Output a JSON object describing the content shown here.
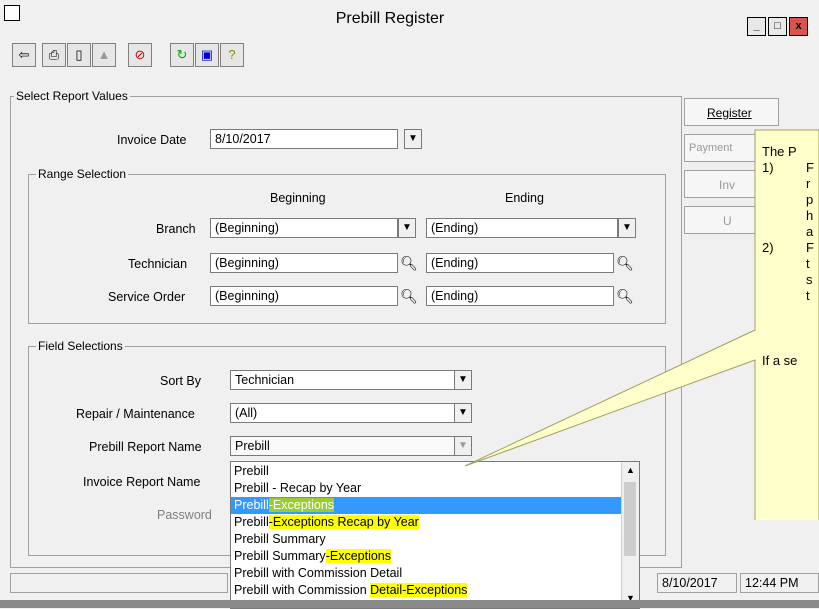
{
  "window": {
    "title": "Prebill Register",
    "minimize": "_",
    "maximize": "□",
    "close": "x"
  },
  "toolbar": [
    "exit-icon",
    "print-icon",
    "preview-icon",
    "export-icon",
    "cancel-icon",
    "refresh-icon",
    "copy-icon",
    "help-icon"
  ],
  "select_group": {
    "label": "Select Report Values"
  },
  "invoice_date": {
    "label": "Invoice Date",
    "value": "8/10/2017"
  },
  "range": {
    "label": "Range Selection",
    "col_beginning": "Beginning",
    "col_ending": "Ending",
    "branch": {
      "label": "Branch",
      "begin": "(Beginning)",
      "end": "(Ending)"
    },
    "technician": {
      "label": "Technician",
      "begin": "(Beginning)",
      "end": "(Ending)"
    },
    "service_order": {
      "label": "Service Order",
      "begin": "(Beginning)",
      "end": "(Ending)"
    }
  },
  "fields": {
    "label": "Field Selections",
    "sort_by": {
      "label": "Sort By",
      "value": "Technician"
    },
    "repair": {
      "label": "Repair / Maintenance",
      "value": "(All)"
    },
    "prebill_report": {
      "label": "Prebill Report Name",
      "value": "Prebill"
    },
    "invoice_report": {
      "label": "Invoice Report Name"
    },
    "password": {
      "label": "Password"
    }
  },
  "dropdown_list": [
    {
      "a": "Prebill",
      "b": ""
    },
    {
      "a": "Prebill - Recap by Year",
      "b": ""
    },
    {
      "a": "Prebill",
      "b": "-Exceptions"
    },
    {
      "a": "Prebill",
      "b": "-Exceptions Recap by Year"
    },
    {
      "a": "Prebill Summary",
      "b": ""
    },
    {
      "a": "Prebill Summary",
      "b": "-Exceptions"
    },
    {
      "a": "Prebill with Commission Detail",
      "b": ""
    },
    {
      "a": "Prebill with Commission ",
      "b": "Detail-Exceptions"
    }
  ],
  "right_buttons": {
    "register": "Register",
    "payment": "Payment",
    "inv": "Inv",
    "u": "U"
  },
  "callout": {
    "line0": "The P",
    "n1": "1)",
    "n2": "2)",
    "l1": "F",
    "l2": "r",
    "l3": "p",
    "l4": "h",
    "l5": "a",
    "l6": "F",
    "l7": "t",
    "l8": "s",
    "l9": "t",
    "bottom": "If a se"
  },
  "status": {
    "date": "8/10/2017",
    "time": "12:44 PM"
  }
}
